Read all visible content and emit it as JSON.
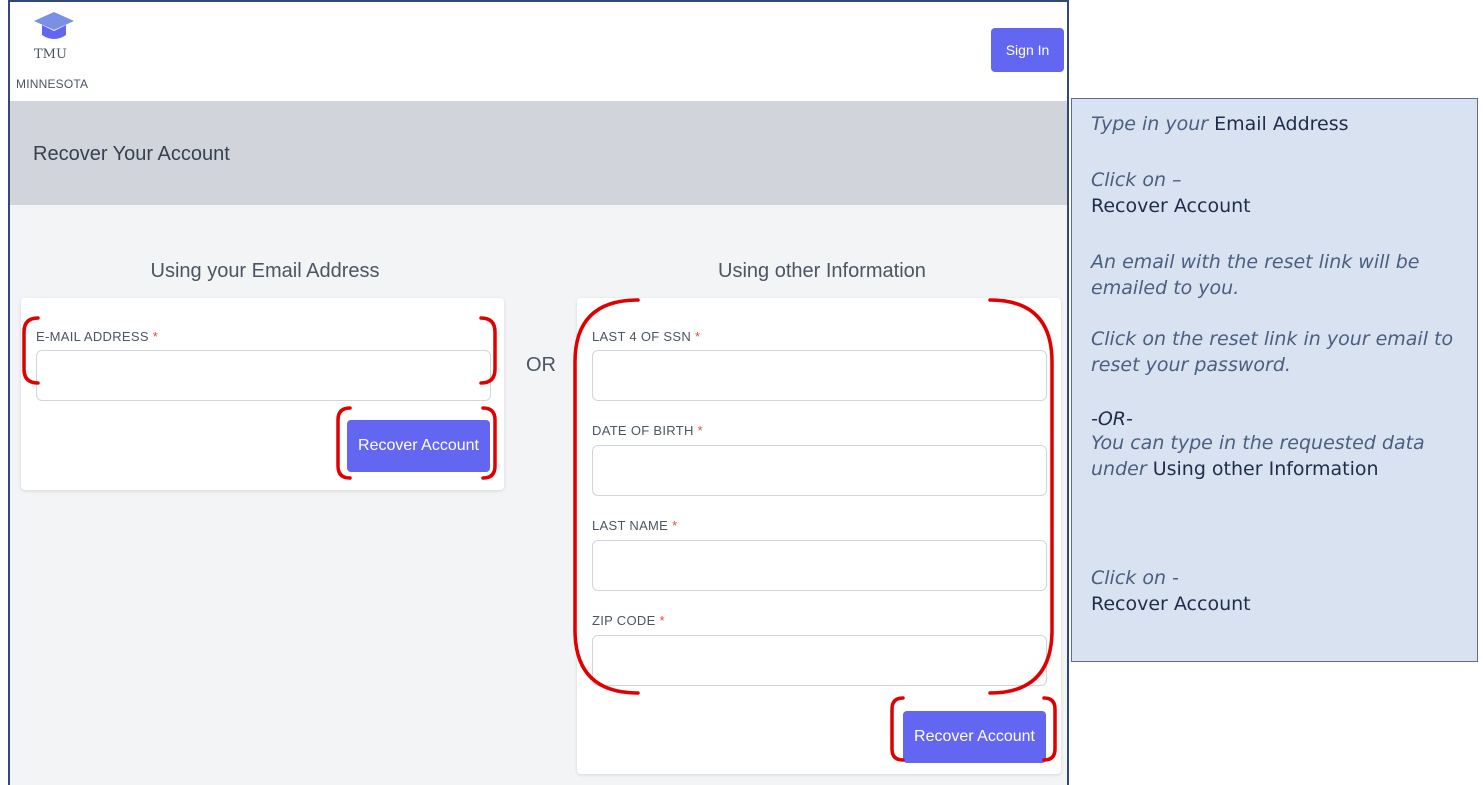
{
  "app": {
    "logo_name": "TMU",
    "logo_state": "MINNESOTA",
    "sign_in_label": "Sign In",
    "page_title": "Recover Your Account"
  },
  "email_section": {
    "title": "Using your Email Address",
    "email_label": "E-MAIL ADDRESS",
    "required_mark": "*",
    "email_value": "",
    "button_label": "Recover Account"
  },
  "separator": "OR",
  "other_section": {
    "title": "Using other Information",
    "fields": [
      {
        "label": "LAST 4 OF SSN",
        "value": ""
      },
      {
        "label": "DATE OF BIRTH",
        "value": ""
      },
      {
        "label": "LAST NAME",
        "value": ""
      },
      {
        "label": "ZIP CODE",
        "value": ""
      }
    ],
    "required_mark": "*",
    "button_label": "Recover Account"
  },
  "instructions": {
    "step1_prefix": "Type in your",
    "step1_target": "Email Address",
    "step2_prefix": "Click on –",
    "step2_target": "Recover Account",
    "step3": "An email with the reset link will be emailed to you.",
    "step4": "Click on the reset link in your email to reset your password.",
    "or_marker": "-OR-",
    "step5_prefix": "You can type in the requested data under",
    "step5_target": "Using other Information",
    "step6_prefix": "Click on -",
    "step6_target": "Recover Account"
  },
  "colors": {
    "accent": "#6366f1",
    "required": "#ef4444",
    "highlight_bracket": "#e00000",
    "panel_bg": "#d9e2f1"
  }
}
